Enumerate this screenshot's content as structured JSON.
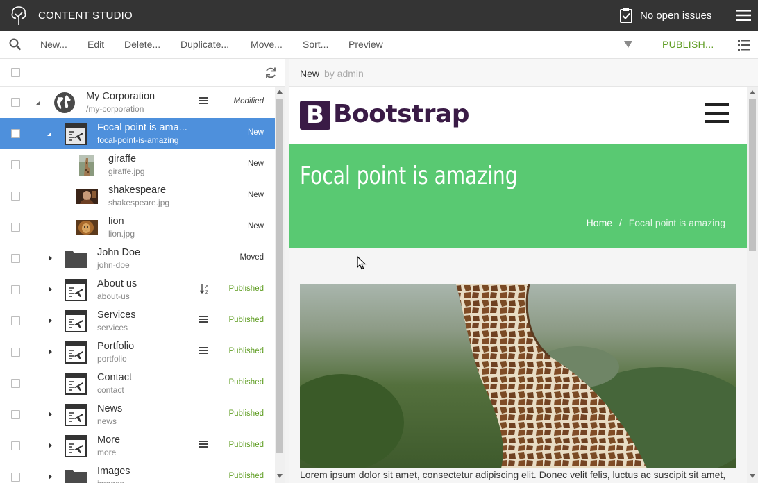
{
  "app": {
    "title": "CONTENT STUDIO",
    "issues_label": "No open issues"
  },
  "toolbar": {
    "items": [
      "New...",
      "Edit",
      "Delete...",
      "Duplicate...",
      "Move...",
      "Sort...",
      "Preview"
    ],
    "publish_label": "PUBLISH..."
  },
  "tree": {
    "rows": [
      {
        "name": "My Corporation",
        "path": "/my-corporation",
        "status": "Modified",
        "icon": "globe-icon"
      },
      {
        "name": "Focal point is ama...",
        "path": "focal-point-is-amazing",
        "status": "New",
        "icon": "page-icon"
      },
      {
        "name": "giraffe",
        "path": "giraffe.jpg",
        "status": "New",
        "icon": "image-thumb"
      },
      {
        "name": "shakespeare",
        "path": "shakespeare.jpg",
        "status": "New",
        "icon": "image-thumb"
      },
      {
        "name": "lion",
        "path": "lion.jpg",
        "status": "New",
        "icon": "image-thumb"
      },
      {
        "name": "John Doe",
        "path": "john-doe",
        "status": "Moved",
        "icon": "folder-icon"
      },
      {
        "name": "About us",
        "path": "about-us",
        "status": "Published",
        "icon": "page-icon"
      },
      {
        "name": "Services",
        "path": "services",
        "status": "Published",
        "icon": "page-icon"
      },
      {
        "name": "Portfolio",
        "path": "portfolio",
        "status": "Published",
        "icon": "page-icon"
      },
      {
        "name": "Contact",
        "path": "contact",
        "status": "Published",
        "icon": "page-icon"
      },
      {
        "name": "News",
        "path": "news",
        "status": "Published",
        "icon": "page-icon"
      },
      {
        "name": "More",
        "path": "more",
        "status": "Published",
        "icon": "page-icon"
      },
      {
        "name": "Images",
        "path": "images",
        "status": "Published",
        "icon": "folder-icon"
      }
    ]
  },
  "preview_panel": {
    "state": "New",
    "by": "by admin",
    "site": {
      "logo_letter": "B",
      "logo_text": "Bootstrap",
      "hero_title": "Focal point is amazing",
      "breadcrumb_home": "Home",
      "breadcrumb_sep": "/",
      "breadcrumb_current": "Focal point is amazing",
      "body_text": "Lorem ipsum dolor sit amet, consectetur adipiscing elit. Donec velit felis, luctus ac suscipit sit amet,"
    }
  },
  "colors": {
    "appbar": "#343434",
    "selected": "#4e90dc",
    "published": "#609e24",
    "hero": "#59c972",
    "brand": "#3a1b46"
  }
}
